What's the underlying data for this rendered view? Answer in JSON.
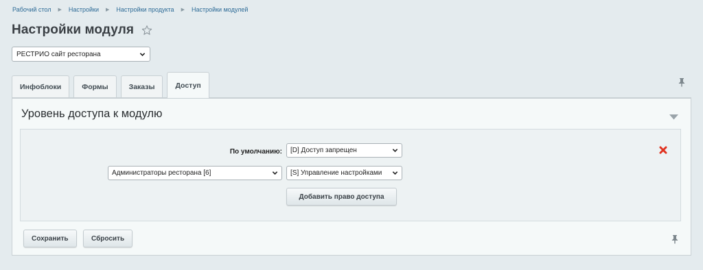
{
  "breadcrumb": [
    "Рабочий стол",
    "Настройки",
    "Настройки продукта",
    "Настройки модулей"
  ],
  "page": {
    "title": "Настройки модуля"
  },
  "site_select": {
    "value": "РЕСТРИО сайт ресторана"
  },
  "tabs": [
    {
      "label": "Инфоблоки"
    },
    {
      "label": "Формы"
    },
    {
      "label": "Заказы"
    },
    {
      "label": "Доступ"
    }
  ],
  "section": {
    "title": "Уровень доступа к модулю"
  },
  "access": {
    "default_label": "По умолчанию:",
    "default_value": "[D] Доступ запрещен",
    "group_value": "Администраторы ресторана [6]",
    "group_right_value": "[S] Управление настройками",
    "add_button": "Добавить право доступа"
  },
  "footer": {
    "save_label": "Сохранить",
    "reset_label": "Сбросить"
  },
  "icons": [
    "star-icon",
    "pin-icon",
    "collapse-triangle-icon",
    "delete-icon",
    "chevron-down-icon"
  ],
  "colors": {
    "link": "#2c6a96",
    "delete": "#e0321f",
    "background": "#e4ebee"
  }
}
